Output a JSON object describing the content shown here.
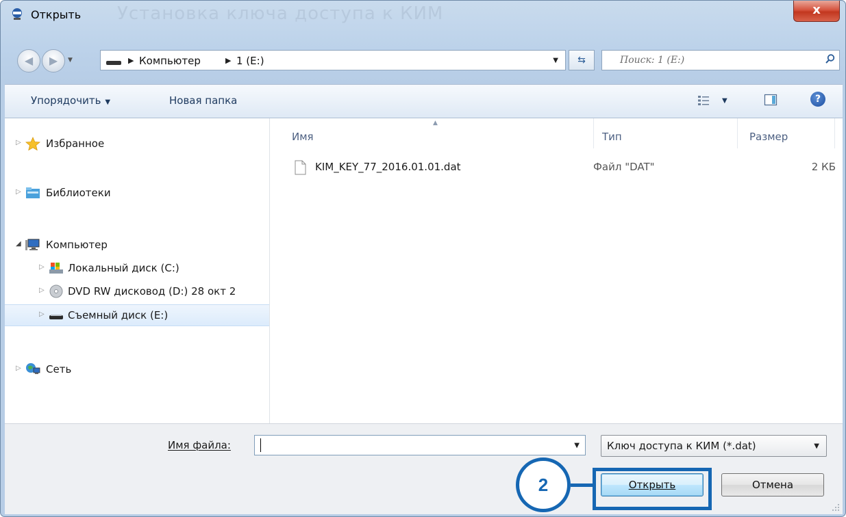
{
  "window": {
    "title": "Открыть",
    "close_glyph": "x",
    "background_ghost_text": "Установка ключа доступа к КИМ"
  },
  "nav": {
    "back_glyph": "◀",
    "forward_glyph": "▶",
    "breadcrumb": [
      {
        "label": "Компьютер"
      },
      {
        "label": "1 (E:)"
      }
    ],
    "search_placeholder": "Поиск: 1 (E:)"
  },
  "toolbar": {
    "organize_label": "Упорядочить",
    "new_folder_label": "Новая папка",
    "help_glyph": "?"
  },
  "sidebar": {
    "favorites": "Избранное",
    "libraries": "Библиотеки",
    "computer": "Компьютер",
    "local_disk": "Локальный диск (C:)",
    "dvd": "DVD RW дисковод (D:) 28 окт 2",
    "removable": "Съемный диск (E:)",
    "network": "Сеть"
  },
  "filelist": {
    "columns": {
      "name": "Имя",
      "type": "Тип",
      "size": "Размер"
    },
    "files": [
      {
        "name": "KIM_KEY_77_2016.01.01.dat",
        "type": "Файл \"DAT\"",
        "size": "2 КБ"
      }
    ]
  },
  "bottom": {
    "filename_label": "Имя файла:",
    "filename_value": "",
    "filter_value": "Ключ доступа к КИМ (*.dat)",
    "open_label": "Открыть",
    "cancel_label": "Отмена",
    "step_number": "2"
  },
  "colors": {
    "highlight": "#1667b3",
    "selected_row": "#dcebfc"
  }
}
